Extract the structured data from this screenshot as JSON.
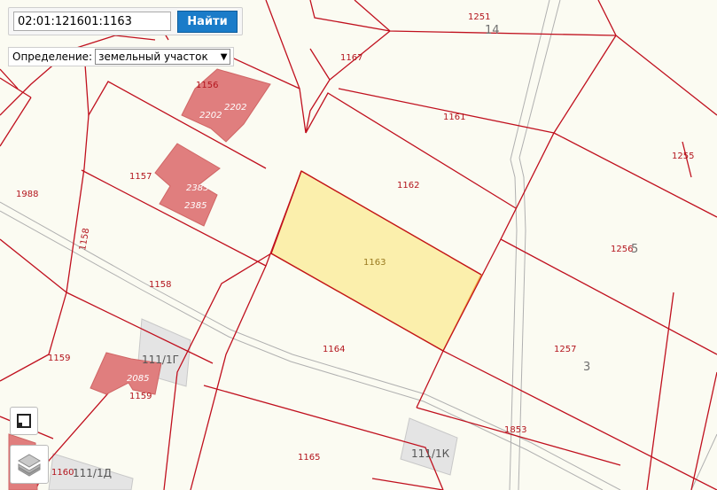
{
  "search": {
    "value": "02:01:121601:1163",
    "button_label": "Найти"
  },
  "definition": {
    "label": "Определение:",
    "selected": "земельный участок"
  },
  "map": {
    "plot_labels": [
      "1251",
      "1167",
      "1156",
      "2202",
      "1161",
      "1255",
      "1157",
      "1162",
      "1988",
      "1158",
      "1256",
      "1163",
      "1158",
      "1159",
      "1257",
      "1164",
      "1159",
      "1853",
      "1165",
      "1160"
    ],
    "block_labels": [
      "14",
      "5",
      "3"
    ],
    "building_labels": [
      "2202",
      "2385",
      "2385",
      "2085"
    ],
    "address_labels": [
      "111/1Г",
      "111/1К",
      "111/1Д"
    ],
    "selected_parcel": "1163"
  },
  "colors": {
    "boundary": "#c0101e",
    "building": "#e07e7e",
    "selected_fill": "#fbeea5",
    "selected_stroke": "#f0a030",
    "background": "#fbfbf2"
  },
  "controls": {
    "fullscreen_icon": "fullscreen-icon",
    "layers_icon": "layers-icon"
  }
}
